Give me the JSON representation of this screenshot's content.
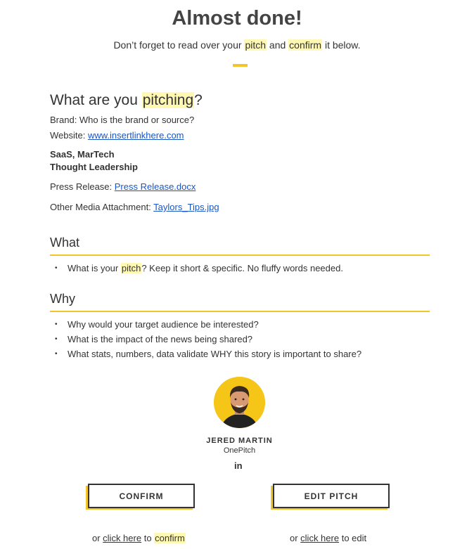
{
  "header": {
    "title": "Almost done!",
    "sub_prefix": "Don’t forget to read over your ",
    "sub_pitch": "pitch",
    "sub_and": " and ",
    "sub_confirm": "confirm",
    "sub_suffix": " it below."
  },
  "pitch": {
    "title_prefix": "What are you ",
    "title_highlight": "pitching",
    "title_suffix": "?",
    "brand_line": "Brand: Who is the brand or source?",
    "website_label": "Website: ",
    "website_link": "www.insertlinkhere.com",
    "category": "SaaS, MarTech",
    "type": "Thought Leadership",
    "press_label": "Press Release: ",
    "press_link": "Press Release.docx",
    "media_label": "Other Media Attachment: ",
    "media_link": "Taylors_Tips.jpg"
  },
  "what": {
    "heading": "What",
    "bullet_prefix": "What is your ",
    "bullet_highlight": "pitch",
    "bullet_suffix": "? Keep it short & specific. No fluffy words needed."
  },
  "why": {
    "heading": "Why",
    "bullets": [
      "Why would your target audience be interested?",
      "What is the impact of the news being shared?",
      "What stats, numbers, data validate WHY this story is important to share?"
    ]
  },
  "profile": {
    "name": "JERED MARTIN",
    "company": "OnePitch",
    "social_icon": "linkedin-icon",
    "social_text": "in"
  },
  "actions": {
    "confirm_label": "CONFIRM",
    "edit_label": "EDIT PITCH",
    "confirm_or": "or ",
    "confirm_click": "click here",
    "confirm_to": " to ",
    "confirm_word": "confirm",
    "edit_or": "or ",
    "edit_click": "click here",
    "edit_to": " to edit"
  },
  "colors": {
    "accent": "#f2c62b",
    "highlight": "#fff8b3",
    "link": "#1a55c4"
  }
}
